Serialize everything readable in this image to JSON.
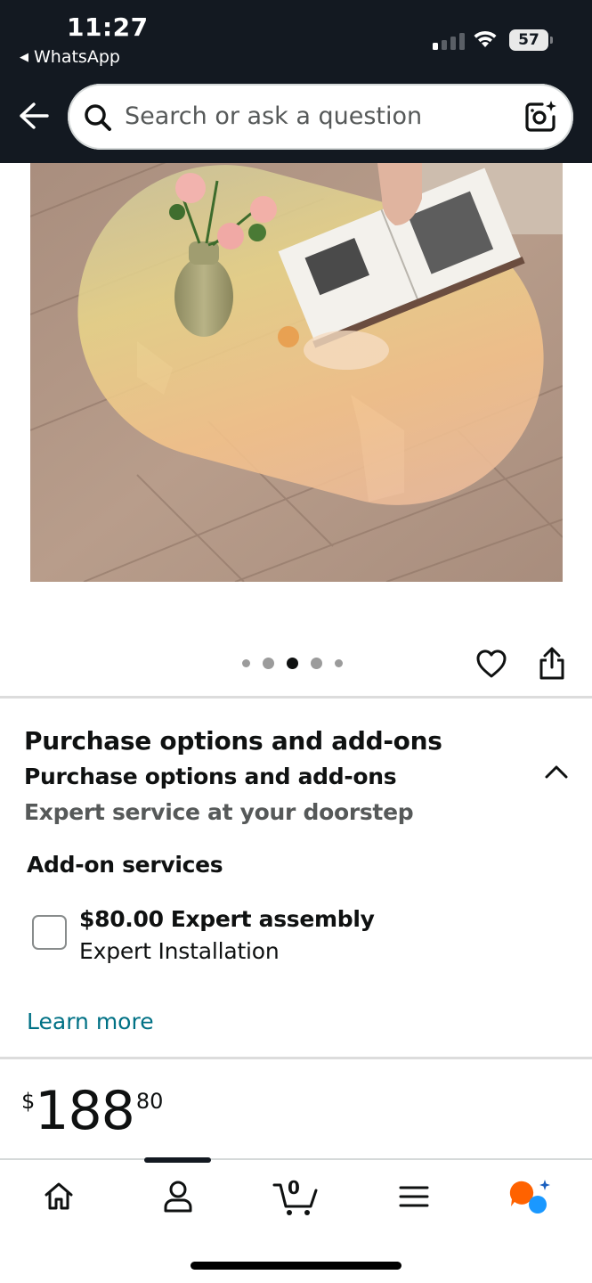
{
  "status_bar": {
    "time": "11:27",
    "back_app": "WhatsApp",
    "battery": "57",
    "signal_bars_filled": 1,
    "signal_bars_total": 4
  },
  "header": {
    "search_placeholder": "Search or ask a question",
    "icons": [
      "back-arrow-icon",
      "search-icon",
      "camera-icon"
    ]
  },
  "product": {
    "image_index": 3,
    "image_count": 5
  },
  "purchase_options": {
    "title": "Purchase options and add-ons",
    "subtitle": "Purchase options and add-ons",
    "description": "Expert service at your doorstep",
    "addon_heading": "Add-on services",
    "addon": {
      "price": "$80.00",
      "name": "Expert assembly",
      "detail": "Expert Installation",
      "checked": false
    },
    "learn_more": "Learn more"
  },
  "price": {
    "symbol": "$",
    "whole": "188",
    "fraction": "80"
  },
  "bottom_nav": {
    "cart_count": "0",
    "items": [
      "home-icon",
      "account-icon",
      "cart-icon",
      "menu-icon",
      "rufus-icon"
    ]
  },
  "colors": {
    "header_bg": "#131921",
    "link": "#007185",
    "rufus_orange": "#ff6200",
    "rufus_blue": "#1a98ff"
  }
}
